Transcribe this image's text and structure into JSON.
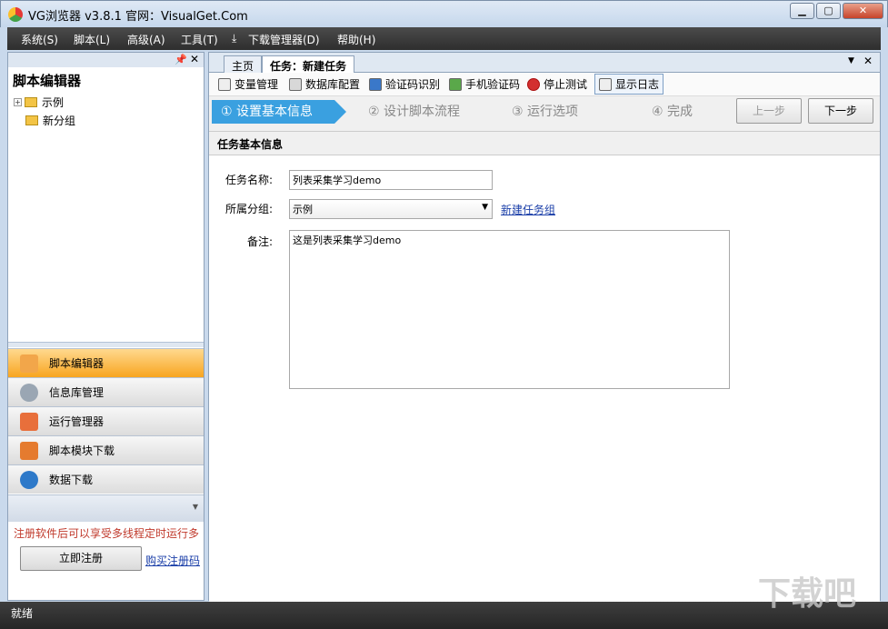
{
  "window": {
    "title": "VG浏览器 v3.8.1 官网：VisualGet.Com"
  },
  "menu": [
    "系统(S)",
    "脚本(L)",
    "高级(A)",
    "工具(T)",
    "下载管理器(D)",
    "帮助(H)"
  ],
  "left": {
    "title": "脚本编辑器",
    "tree": [
      "示例",
      "新分组"
    ],
    "nav": [
      {
        "label": "脚本编辑器",
        "icon": "script-editor-icon",
        "color": "#f2a64a"
      },
      {
        "label": "信息库管理",
        "icon": "database-icon",
        "color": "#9aa6b3"
      },
      {
        "label": "运行管理器",
        "icon": "calendar-icon",
        "color": "#e86f3b"
      },
      {
        "label": "脚本模块下载",
        "icon": "module-icon",
        "color": "#e57b2f"
      },
      {
        "label": "数据下载",
        "icon": "download-icon",
        "color": "#2e79c9"
      }
    ],
    "register_tip": "注册软件后可以享受多线程定时运行多",
    "register_button": "立即注册",
    "buy_link": "购买注册码"
  },
  "tabs": [
    "主页",
    "任务：新建任务"
  ],
  "toolbar": [
    "变量管理",
    "数据库配置",
    "验证码识别",
    "手机验证码",
    "停止测试",
    "显示日志"
  ],
  "wizard": {
    "steps": [
      "① 设置基本信息",
      "② 设计脚本流程",
      "③ 运行选项",
      "④ 完成"
    ],
    "prev": "上一步",
    "next": "下一步"
  },
  "form": {
    "header": "任务基本信息",
    "name_label": "任务名称:",
    "name_value": "列表采集学习demo",
    "group_label": "所属分组:",
    "group_value": "示例",
    "new_group_link": "新建任务组",
    "note_label": "备注:",
    "note_value": "这是列表采集学习demo"
  },
  "status": "就绪",
  "watermark": "下载吧",
  "colors": {
    "accent": "#3aa0e0",
    "active_nav": "#f8a520",
    "link": "#1a3ea8",
    "error": "#c0392b"
  }
}
